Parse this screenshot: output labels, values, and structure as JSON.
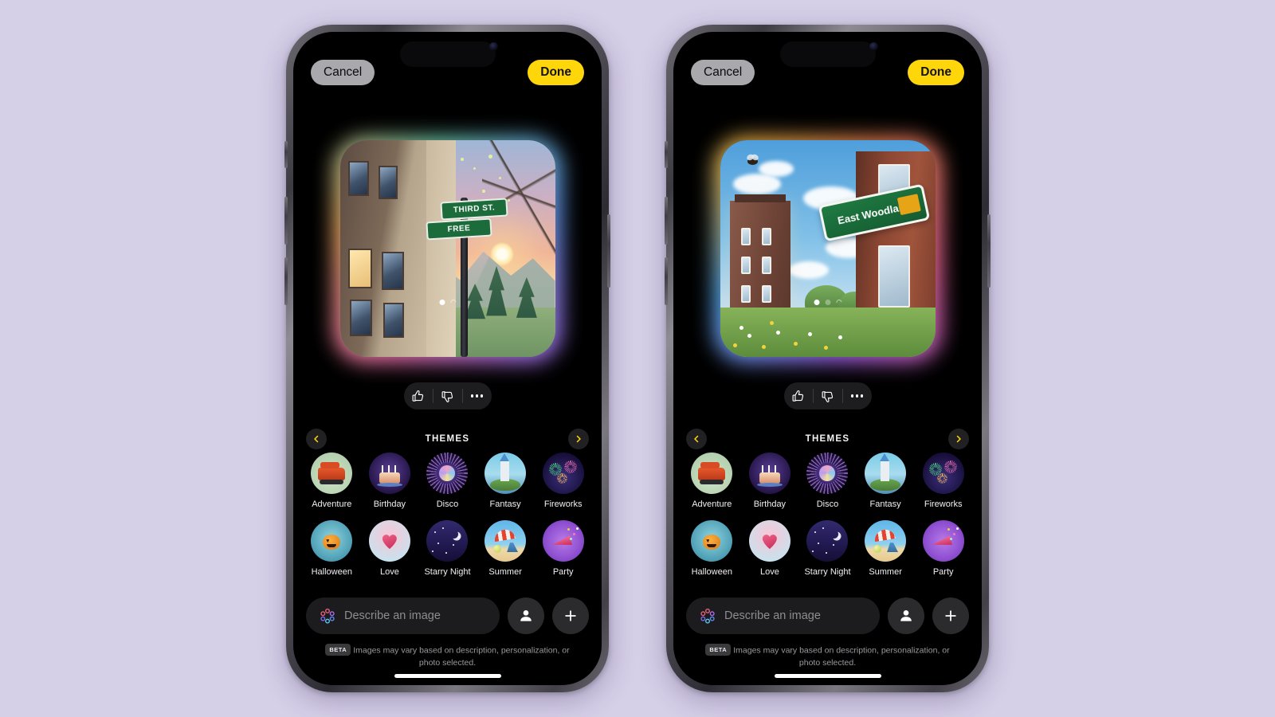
{
  "app": {
    "name": "Image Playground",
    "background_color": "#d6cfe8"
  },
  "topbar": {
    "cancel_label": "Cancel",
    "done_label": "Done",
    "cancel_color": "#a8a8ad",
    "done_color": "#ffd60a"
  },
  "phones": [
    {
      "id": "left",
      "image": {
        "description": "Illustrated street sign at corner of a city building fading into a sunset mountain landscape",
        "sign_top_text": "THIRD ST.",
        "sign_bottom_text": "FREE",
        "style": "animation"
      },
      "page_dots": [
        {
          "state": "active"
        },
        {
          "state": "loading"
        }
      ],
      "feedback": {
        "thumbs_up": "thumbs-up",
        "thumbs_down": "thumbs-down",
        "more": "more-options"
      }
    },
    {
      "id": "right",
      "image": {
        "description": "3D brick building with a green street sign over a flowering meadow and blue sky",
        "sign_text": "East Woodland",
        "style": "3d-illustration"
      },
      "page_dots": [
        {
          "state": "active"
        },
        {
          "state": "inactive"
        },
        {
          "state": "loading"
        }
      ],
      "feedback": {
        "thumbs_up": "thumbs-up",
        "thumbs_down": "thumbs-down",
        "more": "more-options"
      }
    }
  ],
  "themes_section": {
    "title": "THEMES",
    "prev_icon": "chevron-left-icon",
    "next_icon": "chevron-right-icon",
    "arrow_color": "#ffd60a",
    "items": [
      {
        "label": "Adventure",
        "icon": "adventure-jeep-icon"
      },
      {
        "label": "Birthday",
        "icon": "birthday-cake-icon"
      },
      {
        "label": "Disco",
        "icon": "disco-ball-icon"
      },
      {
        "label": "Fantasy",
        "icon": "fantasy-castle-icon"
      },
      {
        "label": "Fireworks",
        "icon": "fireworks-icon"
      },
      {
        "label": "Halloween",
        "icon": "halloween-pumpkin-icon"
      },
      {
        "label": "Love",
        "icon": "love-heart-icon"
      },
      {
        "label": "Starry Night",
        "icon": "starry-night-icon"
      },
      {
        "label": "Summer",
        "icon": "summer-beach-icon"
      },
      {
        "label": "Party",
        "icon": "party-popper-icon"
      }
    ]
  },
  "input_bar": {
    "placeholder": "Describe an image",
    "value": "",
    "playground_icon": "image-playground-icon",
    "person_icon": "person-icon",
    "add_icon": "plus-icon"
  },
  "disclaimer": {
    "badge": "BETA",
    "text": "Images may vary based on description, personalization, or photo selected."
  }
}
